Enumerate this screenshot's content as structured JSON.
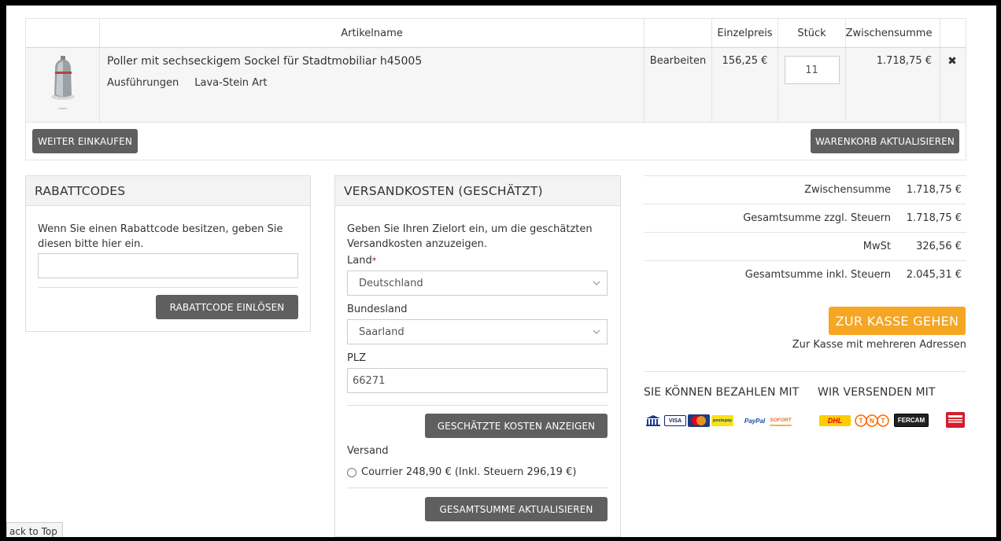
{
  "cart": {
    "headers": {
      "name": "Artikelname",
      "price": "Einzelpreis",
      "qty": "Stück",
      "subtotal": "Zwischensumme"
    },
    "item": {
      "name": "Poller mit sechseckigem Sockel für Stadtmobiliar h45005",
      "variant_label": "Ausführungen",
      "variant_value": "Lava-Stein Art",
      "edit_label": "Bearbeiten",
      "unit_price": "156,25 €",
      "quantity": "11",
      "subtotal": "1.718,75 €",
      "delete_icon": "✖"
    },
    "continue_label": "WEITER EINKAUFEN",
    "update_label": "WARENKORB AKTUALISIEREN"
  },
  "coupon": {
    "title": "RABATTCODES",
    "text": "Wenn Sie einen Rabattcode besitzen, geben Sie diesen bitte hier ein.",
    "input_value": "",
    "button_label": "RABATTCODE EINLÖSEN"
  },
  "shipping": {
    "title": "VERSANDKOSTEN (GESCHÄTZT)",
    "intro": "Geben Sie Ihren Zielort ein, um die geschätzten Versandkosten anzuzeigen.",
    "country_label": "Land",
    "country_required_mark": "*",
    "country_value": "Deutschland",
    "state_label": "Bundesland",
    "state_value": "Saarland",
    "zip_label": "PLZ",
    "zip_value": "66271",
    "estimate_button": "GESCHÄTZTE KOSTEN ANZEIGEN",
    "method_title": "Versand",
    "option_label": "Courrier 248,90 € (Inkl. Steuern 296,19 €)",
    "update_total_button": "GESAMTSUMME AKTUALISIEREN"
  },
  "totals": {
    "subtotal_label": "Zwischensumme",
    "subtotal_value": "1.718,75 €",
    "total_excl_label": "Gesamtsumme zzgl. Steuern",
    "total_excl_value": "1.718,75 €",
    "tax_label": "MwSt",
    "tax_value": "326,56 €",
    "total_incl_label": "Gesamtsumme inkl. Steuern",
    "total_incl_value": "2.045,31 €",
    "checkout_label": "ZUR KASSE GEHEN",
    "multi_address_label": "Zur Kasse mit mehreren Adressen"
  },
  "payment": {
    "pay_title": "SIE KÖNNEN BEZAHLEN MIT",
    "ship_title": "WIR VERSENDEN MIT",
    "pay_logos": [
      "bank-icon",
      "VISA",
      "MasterCard",
      "postepay",
      "PayPal",
      "SOFORT"
    ],
    "ship_logos": [
      "DHL",
      "TNT",
      "FERCAM",
      "BARTOLINI"
    ],
    "visa": "VISA",
    "paypal": "PayPal",
    "sofort": "SOFORT",
    "postepay": "postepay",
    "dhl": "DHL",
    "tnt": "TNT",
    "fercam": "FERCAM"
  },
  "back_to_top": "ack to Top",
  "colors": {
    "button_dark": "#5f5f5f",
    "checkout_orange": "#f5a623",
    "panel_header": "#f3f3f3",
    "item_row": "#f6f6f6"
  }
}
